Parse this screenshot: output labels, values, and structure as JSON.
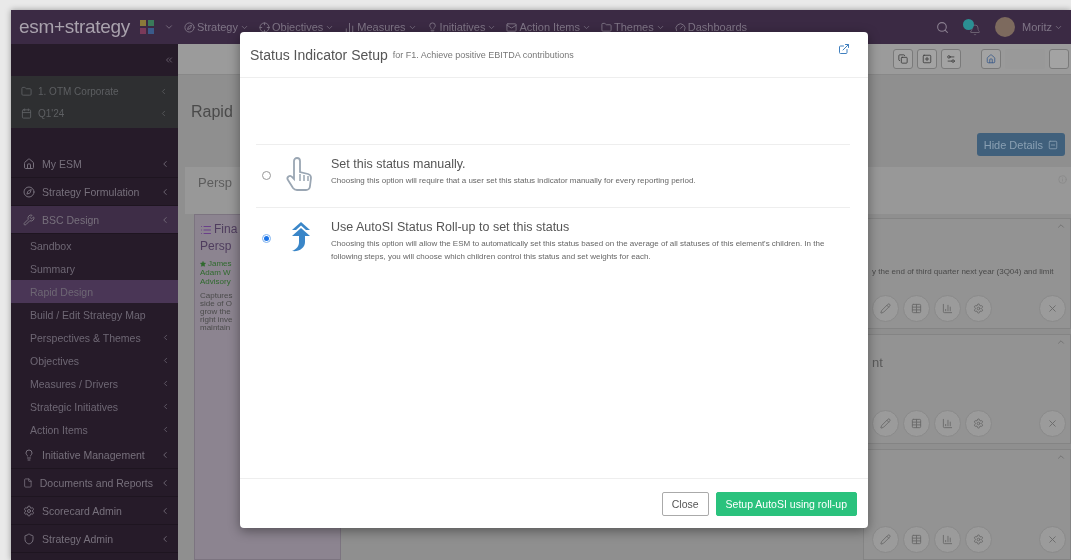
{
  "header": {
    "logo": "esm+strategy",
    "nav": [
      {
        "label": "Strategy",
        "dropdown": true
      },
      {
        "label": "Objectives",
        "dropdown": true
      },
      {
        "label": "Measures",
        "dropdown": true
      },
      {
        "label": "Initiatives",
        "dropdown": true
      },
      {
        "label": "Action Items",
        "dropdown": true
      },
      {
        "label": "Themes",
        "dropdown": true
      },
      {
        "label": "Dashboards",
        "dropdown": false
      }
    ],
    "user": "Moritz"
  },
  "sidebar": {
    "context": [
      {
        "label": "1. OTM Corporate"
      },
      {
        "label": "Q1'24"
      }
    ],
    "items": [
      {
        "label": "My ESM",
        "selected": false
      },
      {
        "label": "Strategy Formulation",
        "selected": false
      },
      {
        "label": "BSC Design",
        "selected": true,
        "children": [
          {
            "label": "Sandbox",
            "selected": false,
            "has_submenu": false
          },
          {
            "label": "Summary",
            "selected": false,
            "has_submenu": false
          },
          {
            "label": "Rapid Design",
            "selected": true,
            "has_submenu": false
          },
          {
            "label": "Build / Edit Strategy Map",
            "selected": false,
            "has_submenu": false
          },
          {
            "label": "Perspectives & Themes",
            "selected": false,
            "has_submenu": true
          },
          {
            "label": "Objectives",
            "selected": false,
            "has_submenu": true
          },
          {
            "label": "Measures / Drivers",
            "selected": false,
            "has_submenu": true
          },
          {
            "label": "Strategic Initiatives",
            "selected": false,
            "has_submenu": true
          },
          {
            "label": "Action Items",
            "selected": false,
            "has_submenu": true
          }
        ]
      },
      {
        "label": "Initiative Management",
        "selected": false
      },
      {
        "label": "Documents and Reports",
        "selected": false
      },
      {
        "label": "Scorecard Admin",
        "selected": false
      },
      {
        "label": "Strategy Admin",
        "selected": false
      }
    ]
  },
  "main": {
    "title": "Rapid",
    "perspective": "Persp",
    "hide_details": "Hide Details",
    "left_card": {
      "title_lines": [
        "Fina",
        "Persp"
      ],
      "owners": [
        "James",
        "Adam W",
        "Advisory"
      ],
      "description_lines": [
        "Captures",
        "side of O",
        "grow the",
        "right inve",
        "maintain"
      ]
    },
    "right_cards": [
      {
        "expanded": true,
        "text": "y the end of third quarter next year (3Q04) and limit"
      },
      {
        "expanded": true,
        "title": "nt"
      },
      {
        "expanded": true
      }
    ]
  },
  "modal": {
    "title": "Status Indicator Setup",
    "subtitle": "for F1. Achieve positive EBITDA contributions",
    "options": [
      {
        "kind": "manual",
        "title": "Set this status manually.",
        "description": "Choosing this option will require that a user set this status indicator manually for every reporting period.",
        "selected": false
      },
      {
        "kind": "rollup",
        "title": "Use AutoSI Status Roll-up to set this status",
        "description": "Choosing this option will allow the ESM to automatically set this status based on the average of all statuses of this element's children. In the following steps, you will choose which children control this status and set weights for each.",
        "selected": true
      }
    ],
    "buttons": [
      {
        "label": "Close",
        "kind": "default"
      },
      {
        "label": "Setup AutoSI using roll-up",
        "kind": "primary"
      }
    ]
  }
}
